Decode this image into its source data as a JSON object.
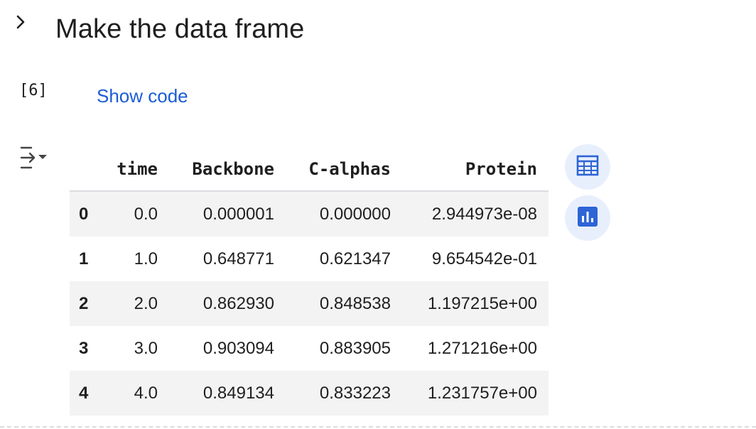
{
  "section": {
    "title": "Make the data frame",
    "toggle_icon": "chevron-right-icon"
  },
  "cell": {
    "exec_count": "[6]",
    "show_code_label": "Show code",
    "output_toggle_icon": "output-toggle-icon"
  },
  "dataframe": {
    "columns": [
      "time",
      "Backbone",
      "C-alphas",
      "Protein"
    ],
    "rows": [
      {
        "index": "0",
        "time": "0.0",
        "backbone": "0.000001",
        "calphas": "0.000000",
        "protein": "2.944973e-08"
      },
      {
        "index": "1",
        "time": "1.0",
        "backbone": "0.648771",
        "calphas": "0.621347",
        "protein": "9.654542e-01"
      },
      {
        "index": "2",
        "time": "2.0",
        "backbone": "0.862930",
        "calphas": "0.848538",
        "protein": "1.197215e+00"
      },
      {
        "index": "3",
        "time": "3.0",
        "backbone": "0.903094",
        "calphas": "0.883905",
        "protein": "1.271216e+00"
      },
      {
        "index": "4",
        "time": "4.0",
        "backbone": "0.849134",
        "calphas": "0.833223",
        "protein": "1.231757e+00"
      }
    ]
  },
  "side_actions": {
    "table_icon": "interactive-table-icon",
    "chart_icon": "suggest-chart-icon"
  },
  "colors": {
    "link": "#1a5cd6",
    "accent_icon": "#2d64d6",
    "button_bg": "#e8effc",
    "row_stripe": "#f3f3f3"
  }
}
